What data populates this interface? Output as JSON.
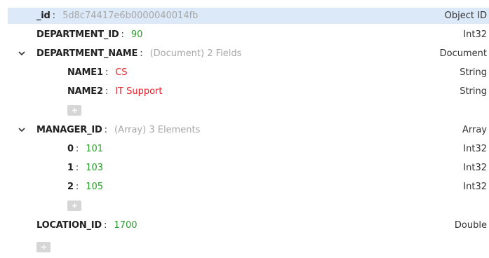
{
  "document": {
    "fields": [
      {
        "key": "_id",
        "value": "5d8c74417e6b0000040014fb",
        "type": "Object ID"
      },
      {
        "key": "DEPARTMENT_ID",
        "value": "90",
        "type": "Int32"
      },
      {
        "key": "DEPARTMENT_NAME",
        "value": "(Document) 2 Fields",
        "type": "Document",
        "children": [
          {
            "key": "NAME1",
            "value": "CS",
            "type": "String"
          },
          {
            "key": "NAME2",
            "value": "IT Support",
            "type": "String"
          }
        ],
        "add_label": "+"
      },
      {
        "key": "MANAGER_ID",
        "value": "(Array) 3 Elements",
        "type": "Array",
        "children": [
          {
            "key": "0",
            "value": "101",
            "type": "Int32"
          },
          {
            "key": "1",
            "value": "103",
            "type": "Int32"
          },
          {
            "key": "2",
            "value": "105",
            "type": "Int32"
          }
        ],
        "add_label": "+"
      },
      {
        "key": "LOCATION_ID",
        "value": "1700",
        "type": "Double"
      }
    ],
    "colon": ":",
    "add_label": "+"
  },
  "colors": {
    "selection": "#dce9f8",
    "string_value": "#e8212a",
    "number_value": "#2c9a2c",
    "muted_value": "#a7a7a7",
    "add_button": "#d6d6d6"
  },
  "icons": {
    "expand": "chevron-down-icon",
    "add": "plus-icon"
  }
}
